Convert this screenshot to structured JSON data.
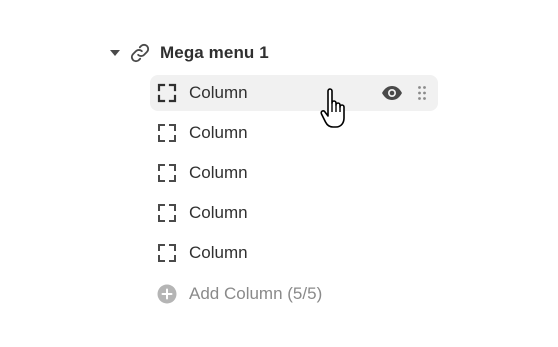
{
  "menu": {
    "parent_label": "Mega menu 1",
    "children": [
      {
        "label": "Column"
      },
      {
        "label": "Column"
      },
      {
        "label": "Column"
      },
      {
        "label": "Column"
      },
      {
        "label": "Column"
      }
    ],
    "add_label": "Add Column (5/5)"
  },
  "colors": {
    "text": "#303030",
    "muted": "#8a8a8a",
    "hover_bg": "#f1f1f1",
    "icon": "#4a4a4a"
  },
  "icons": {
    "caret": "caret-down-icon",
    "parent": "link-icon",
    "child": "column-frame-icon",
    "visibility": "eye-icon",
    "drag": "drag-handle-icon",
    "add": "plus-circle-icon",
    "pointer": "hand-cursor-icon"
  }
}
